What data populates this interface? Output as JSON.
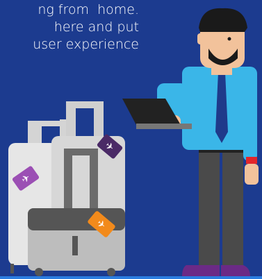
{
  "caption": {
    "lines": [
      "ng from  home.",
      "here and put",
      "user experience"
    ]
  },
  "colors": {
    "background": "#1c3b8f",
    "accent_blue": "#2b7de0",
    "shirt": "#3ab6e8",
    "tie": "#1f3a8a",
    "pants": "#4a4a4a",
    "shoes": "#6b2a86",
    "skin": "#f2c29b",
    "luggage_light": "#d9d9d9",
    "luggage_dark": "#5a5a5a",
    "tag_purple": "#9b4fb4",
    "tag_dark": "#4a2a66",
    "tag_orange": "#f28a1b",
    "laptop": "#222222"
  },
  "icons": [
    "airplane-icon"
  ]
}
